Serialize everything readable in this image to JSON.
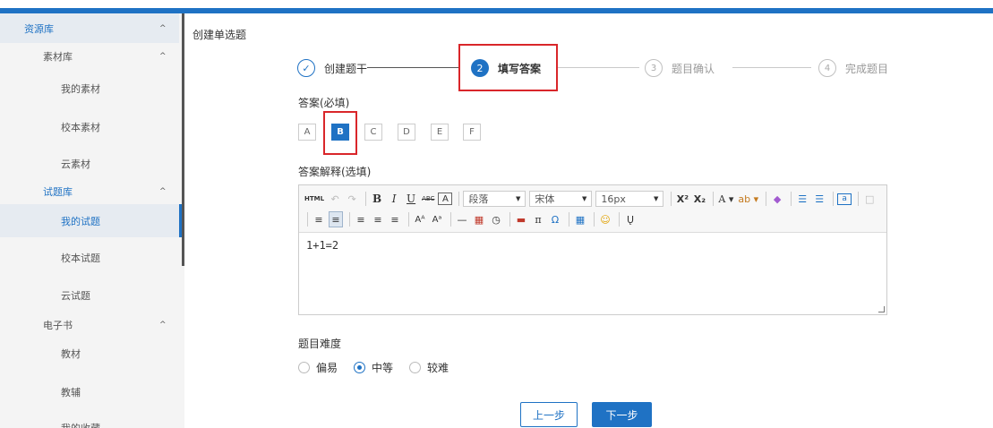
{
  "sidebar": {
    "items": [
      {
        "label": "资源库",
        "chev": "^"
      },
      {
        "label": "素材库",
        "chev": "^"
      },
      {
        "label": "我的素材"
      },
      {
        "label": "校本素材"
      },
      {
        "label": "云素材"
      },
      {
        "label": "试题库",
        "chev": "^"
      },
      {
        "label": "我的试题"
      },
      {
        "label": "校本试题"
      },
      {
        "label": "云试题"
      },
      {
        "label": "电子书",
        "chev": "^"
      },
      {
        "label": "教材"
      },
      {
        "label": "教辅"
      },
      {
        "label": "我的收藏"
      }
    ]
  },
  "breadcrumb": "创建单选题",
  "steps": [
    {
      "num": "✓",
      "label": "创建题干"
    },
    {
      "num": "2",
      "label": "填写答案"
    },
    {
      "num": "3",
      "label": "题目确认"
    },
    {
      "num": "4",
      "label": "完成题目"
    }
  ],
  "answer": {
    "label": "答案(必填)",
    "options": [
      "A",
      "B",
      "C",
      "D",
      "E",
      "F"
    ],
    "selected": "B"
  },
  "explanation": {
    "label": "答案解释(选填)",
    "content": "1+1=2"
  },
  "toolbar": {
    "html": "HTML",
    "paragraph": "段落",
    "font": "宋体",
    "size": "16px"
  },
  "difficulty": {
    "label": "题目难度",
    "options": [
      "偏易",
      "中等",
      "较难"
    ],
    "selected": "中等"
  },
  "buttons": {
    "prev": "上一步",
    "next": "下一步"
  },
  "colors": {
    "primary": "#1f72c4",
    "highlight_box": "#d9262a"
  }
}
